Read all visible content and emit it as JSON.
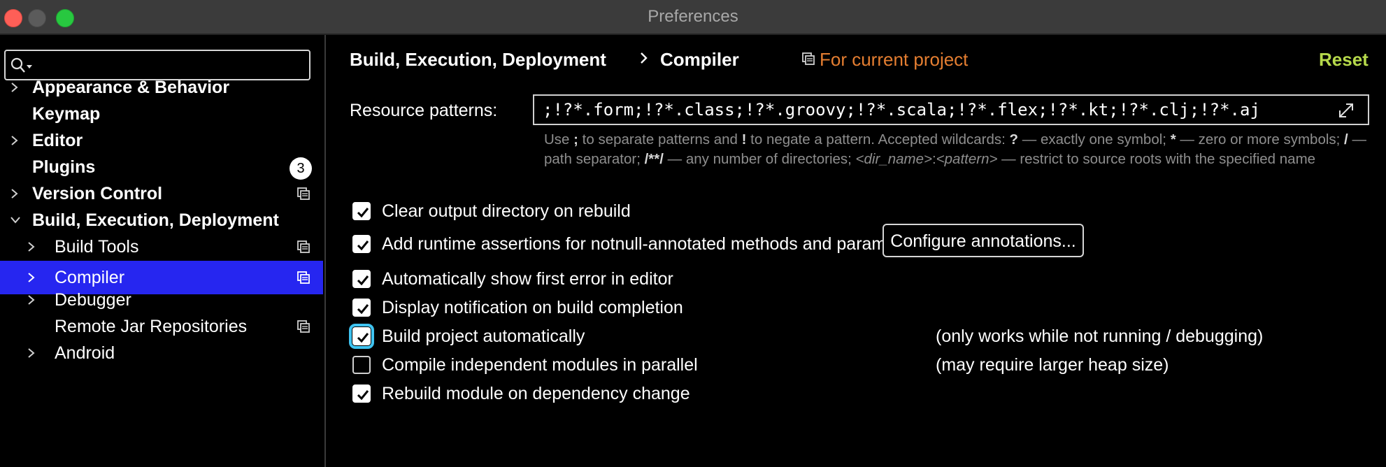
{
  "window": {
    "title": "Preferences"
  },
  "sidebar": {
    "search": {
      "value": "",
      "placeholder": ""
    },
    "items": [
      {
        "label": "Appearance & Behavior",
        "expandable": true,
        "expanded": false
      },
      {
        "label": "Keymap"
      },
      {
        "label": "Editor",
        "expandable": true,
        "expanded": false
      },
      {
        "label": "Plugins",
        "badge": "3"
      },
      {
        "label": "Version Control",
        "expandable": true,
        "expanded": false,
        "icon": "project-scope-icon"
      },
      {
        "label": "Build, Execution, Deployment",
        "expandable": true,
        "expanded": true
      },
      {
        "label": "Build Tools",
        "expandable": true,
        "icon": "project-scope-icon"
      },
      {
        "label": "Compiler",
        "expandable": true,
        "selected": true,
        "icon": "project-scope-icon"
      },
      {
        "label": "Debugger",
        "expandable": true
      },
      {
        "label": "Remote Jar Repositories",
        "icon": "project-scope-icon"
      },
      {
        "label": "Android",
        "expandable": true
      }
    ]
  },
  "header": {
    "breadcrumb": [
      "Build, Execution, Deployment",
      "Compiler"
    ],
    "scope_label": "For current project",
    "reset_label": "Reset"
  },
  "resource_patterns": {
    "label": "Resource patterns:",
    "value": ";!?*.form;!?*.class;!?*.groovy;!?*.scala;!?*.flex;!?*.kt;!?*.clj;!?*.aj",
    "hint": {
      "p1": "Use ",
      "k1": ";",
      "p2": " to separate patterns and ",
      "k2": "!",
      "p3": " to negate a pattern. Accepted wildcards: ",
      "k3": "?",
      "p4": " — exactly one symbol; ",
      "k4": "*",
      "p5": " — zero or more symbols; ",
      "k5": "/",
      "p6": " — path separator; ",
      "k6": "/**/",
      "p7": " — any number of directories; ",
      "i1": "<dir_name>",
      "p8": ":",
      "i2": "<pattern>",
      "p9": " — restrict to source roots with the specified name"
    }
  },
  "options": [
    {
      "label": "Clear output directory on rebuild",
      "checked": true
    },
    {
      "label": "Add runtime assertions for notnull-annotated methods and parameters",
      "checked": true,
      "button": "Configure annotations..."
    },
    {
      "label": "Automatically show first error in editor",
      "checked": true
    },
    {
      "label": "Display notification on build completion",
      "checked": true
    },
    {
      "label": "Build project automatically",
      "checked": true,
      "focused": true,
      "note": "(only works while not running / debugging)"
    },
    {
      "label": "Compile independent modules in parallel",
      "checked": false,
      "note": "(may require larger heap size)"
    },
    {
      "label": "Rebuild module on dependency change",
      "checked": true
    }
  ],
  "colors": {
    "selection": "#2626f0",
    "scope_text": "#e57e31",
    "reset_link": "#b6d94b",
    "focus_ring": "#3fc3f0",
    "hint_text": "#8e8e8e"
  }
}
